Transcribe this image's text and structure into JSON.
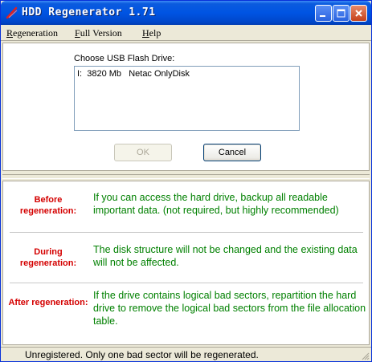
{
  "window": {
    "title": "HDD Regenerator 1.71",
    "controls": {
      "minimize": "_",
      "maximize": "□",
      "close": "✕"
    }
  },
  "menu": {
    "items": [
      {
        "label": "Regeneration"
      },
      {
        "label": "Full Version"
      },
      {
        "label": "Help"
      }
    ]
  },
  "drive_select": {
    "label": "Choose USB Flash Drive:",
    "items": [
      {
        "text": "I:  3820 Mb   Netac OnlyDisk"
      }
    ]
  },
  "buttons": {
    "ok": "OK",
    "cancel": "Cancel"
  },
  "info": [
    {
      "label": "Before regeneration:",
      "text": "If you can access the hard drive, backup all readable important data. (not required, but highly recommended)"
    },
    {
      "label": "During regeneration:",
      "text": "The disk structure will not be changed and the existing data will not be affected."
    },
    {
      "label": "After regeneration:",
      "text": "If the drive contains logical bad sectors, repartition the hard drive to remove the logical bad sectors from the file allocation table."
    }
  ],
  "status": {
    "text": "Unregistered. Only one bad sector will be regenerated."
  },
  "colors": {
    "label_red": "#d40000",
    "text_green": "#008000",
    "title_blue": "#0054e3"
  }
}
